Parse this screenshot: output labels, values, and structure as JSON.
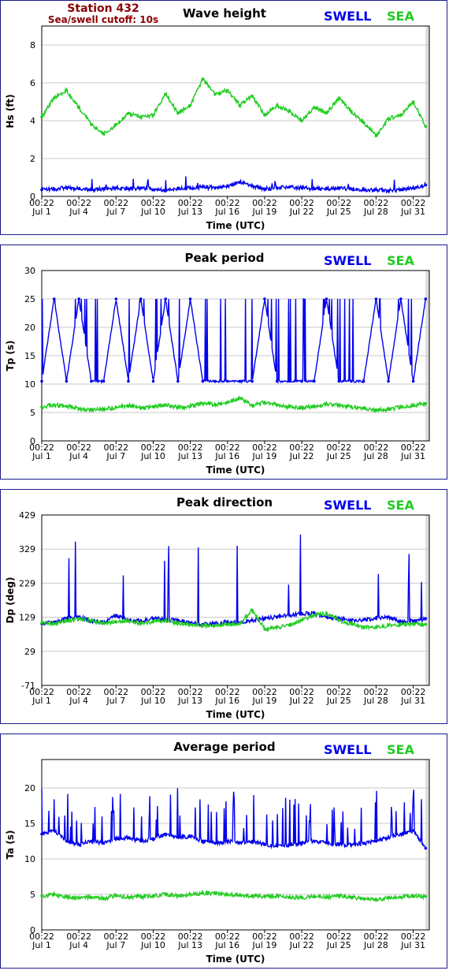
{
  "header": {
    "station": "Station 432",
    "cutoff": "Sea/swell cutoff: 10s"
  },
  "legend": {
    "swell": "SWELL",
    "sea": "SEA"
  },
  "colors": {
    "swell": "#0000ee",
    "sea": "#22cc22",
    "plot_bg": "#ffffff",
    "outer_bg": "#dcdcdc",
    "grid": "#c8c8c8",
    "frame": "#1a1a8c"
  },
  "x_ticks": [
    {
      "time": "00:22",
      "date": "Jul 1"
    },
    {
      "time": "00:22",
      "date": "Jul 4"
    },
    {
      "time": "00:22",
      "date": "Jul 7"
    },
    {
      "time": "00:22",
      "date": "Jul 10"
    },
    {
      "time": "00:22",
      "date": "Jul 13"
    },
    {
      "time": "00:22",
      "date": "Jul 16"
    },
    {
      "time": "00:22",
      "date": "Jul 19"
    },
    {
      "time": "00:22",
      "date": "Jul 22"
    },
    {
      "time": "00:22",
      "date": "Jul 25"
    },
    {
      "time": "00:22",
      "date": "Jul 28"
    },
    {
      "time": "00:22",
      "date": "Jul 31"
    }
  ],
  "chart_data": [
    {
      "type": "line",
      "title": "Wave height",
      "xlabel": "Time (UTC)",
      "ylabel": "Hs (ft)",
      "ylim": [
        0,
        9
      ],
      "yticks": [
        "0",
        "2",
        "4",
        "6",
        "8"
      ],
      "grid": true,
      "legend_position": "top-right",
      "x_range_days": [
        1,
        32.3
      ],
      "x": [
        1,
        2,
        3,
        4,
        5,
        6,
        7,
        8,
        9,
        10,
        11,
        12,
        13,
        14,
        15,
        16,
        17,
        18,
        19,
        20,
        21,
        22,
        23,
        24,
        25,
        26,
        27,
        28,
        29,
        30,
        31,
        32,
        32.3
      ],
      "series": [
        {
          "name": "SWELL",
          "values": [
            0.35,
            0.4,
            0.45,
            0.4,
            0.35,
            0.4,
            0.45,
            0.4,
            0.45,
            0.35,
            0.35,
            0.4,
            0.45,
            0.5,
            0.45,
            0.55,
            0.75,
            0.55,
            0.4,
            0.45,
            0.5,
            0.45,
            0.4,
            0.4,
            0.45,
            0.4,
            0.35,
            0.35,
            0.3,
            0.35,
            0.45,
            0.6,
            0.35
          ]
        },
        {
          "name": "SEA",
          "values": [
            4.2,
            5.2,
            5.6,
            4.7,
            3.8,
            3.3,
            3.8,
            4.4,
            4.2,
            4.3,
            5.4,
            4.4,
            4.8,
            6.2,
            5.4,
            5.6,
            4.8,
            5.3,
            4.3,
            4.8,
            4.5,
            4.0,
            4.7,
            4.4,
            5.2,
            4.5,
            3.9,
            3.2,
            4.1,
            4.3,
            5.0,
            3.7,
            3.6
          ]
        }
      ]
    },
    {
      "type": "line",
      "title": "Peak period",
      "xlabel": "Time (UTC)",
      "ylabel": "Tp (s)",
      "ylim": [
        0,
        30
      ],
      "yticks": [
        "0",
        "5",
        "10",
        "15",
        "20",
        "25",
        "30"
      ],
      "grid": true,
      "legend_position": "top-right",
      "x_range_days": [
        1,
        32.3
      ],
      "x": [
        1,
        2,
        3,
        4,
        5,
        6,
        7,
        8,
        9,
        10,
        11,
        12,
        13,
        14,
        15,
        16,
        17,
        18,
        19,
        20,
        21,
        22,
        23,
        24,
        25,
        26,
        27,
        28,
        29,
        30,
        31,
        32,
        32.3
      ],
      "series": [
        {
          "name": "SWELL",
          "values": [
            10.5,
            25,
            10.5,
            25,
            10.5,
            10.5,
            25,
            10.5,
            25,
            10.5,
            25,
            10.5,
            25,
            10.5,
            10.5,
            10.5,
            10.5,
            10.5,
            25,
            10.5,
            10.5,
            10.5,
            10.5,
            25,
            10.5,
            10.5,
            10.5,
            25,
            10.5,
            25,
            10.5,
            25,
            10.5
          ]
        },
        {
          "name": "SEA",
          "values": [
            6.0,
            6.3,
            6.1,
            5.7,
            5.4,
            5.6,
            5.9,
            6.2,
            5.8,
            6.0,
            6.3,
            5.9,
            6.1,
            6.6,
            6.4,
            6.8,
            7.5,
            6.3,
            6.8,
            6.3,
            6.0,
            5.8,
            6.1,
            6.5,
            6.3,
            6.0,
            5.7,
            5.4,
            5.6,
            5.9,
            6.2,
            6.6,
            5.3
          ]
        }
      ]
    },
    {
      "type": "line",
      "title": "Peak direction",
      "xlabel": "Time (UTC)",
      "ylabel": "Dp (deg)",
      "ylim": [
        -71,
        429
      ],
      "yticks": [
        "-71",
        "29",
        "129",
        "229",
        "329",
        "429"
      ],
      "grid": true,
      "legend_position": "top-right",
      "x_range_days": [
        1,
        32.3
      ],
      "x": [
        1,
        2,
        3,
        4,
        5,
        6,
        7,
        8,
        9,
        10,
        11,
        12,
        13,
        14,
        15,
        16,
        17,
        18,
        19,
        20,
        21,
        22,
        23,
        24,
        25,
        26,
        27,
        28,
        29,
        30,
        31,
        32,
        32.3
      ],
      "series": [
        {
          "name": "SWELL",
          "values": [
            110,
            115,
            125,
            130,
            118,
            112,
            135,
            120,
            118,
            125,
            122,
            120,
            112,
            108,
            110,
            115,
            112,
            120,
            125,
            130,
            135,
            140,
            140,
            130,
            125,
            120,
            122,
            125,
            130,
            115,
            118,
            125,
            140
          ]
        },
        {
          "name": "SEA",
          "values": [
            112,
            110,
            118,
            125,
            120,
            112,
            115,
            118,
            110,
            115,
            120,
            112,
            108,
            105,
            105,
            108,
            110,
            150,
            95,
            100,
            105,
            120,
            135,
            140,
            120,
            110,
            100,
            100,
            105,
            108,
            110,
            108,
            105
          ]
        }
      ]
    },
    {
      "type": "line",
      "title": "Average period",
      "xlabel": "Time (UTC)",
      "ylabel": "Ta (s)",
      "ylim": [
        0,
        24
      ],
      "yticks": [
        "0",
        "5",
        "10",
        "15",
        "20"
      ],
      "grid": true,
      "legend_position": "top-right",
      "x_range_days": [
        1,
        32.3
      ],
      "x": [
        1,
        2,
        3,
        4,
        5,
        6,
        7,
        8,
        9,
        10,
        11,
        12,
        13,
        14,
        15,
        16,
        17,
        18,
        19,
        20,
        21,
        22,
        23,
        24,
        25,
        26,
        27,
        28,
        29,
        30,
        31,
        32,
        32.3
      ],
      "series": [
        {
          "name": "SWELL",
          "values": [
            13.5,
            14,
            12.5,
            12,
            12.5,
            12.2,
            12.8,
            13,
            12.5,
            12.8,
            13.5,
            13,
            13.2,
            12.5,
            12.2,
            12.5,
            12.3,
            12.5,
            12,
            11.8,
            12,
            12.2,
            12.5,
            12.3,
            12,
            12,
            12.2,
            12.5,
            13,
            13.5,
            14,
            11.5,
            11.8
          ]
        },
        {
          "name": "SEA",
          "values": [
            4.8,
            5.0,
            4.7,
            4.5,
            4.6,
            4.4,
            4.8,
            4.6,
            4.7,
            4.8,
            5.0,
            4.8,
            5.0,
            5.2,
            5.1,
            5.0,
            4.9,
            4.8,
            4.7,
            4.8,
            4.6,
            4.5,
            4.7,
            4.6,
            4.8,
            4.6,
            4.4,
            4.3,
            4.5,
            4.6,
            4.8,
            4.7,
            4.4
          ]
        }
      ]
    }
  ]
}
